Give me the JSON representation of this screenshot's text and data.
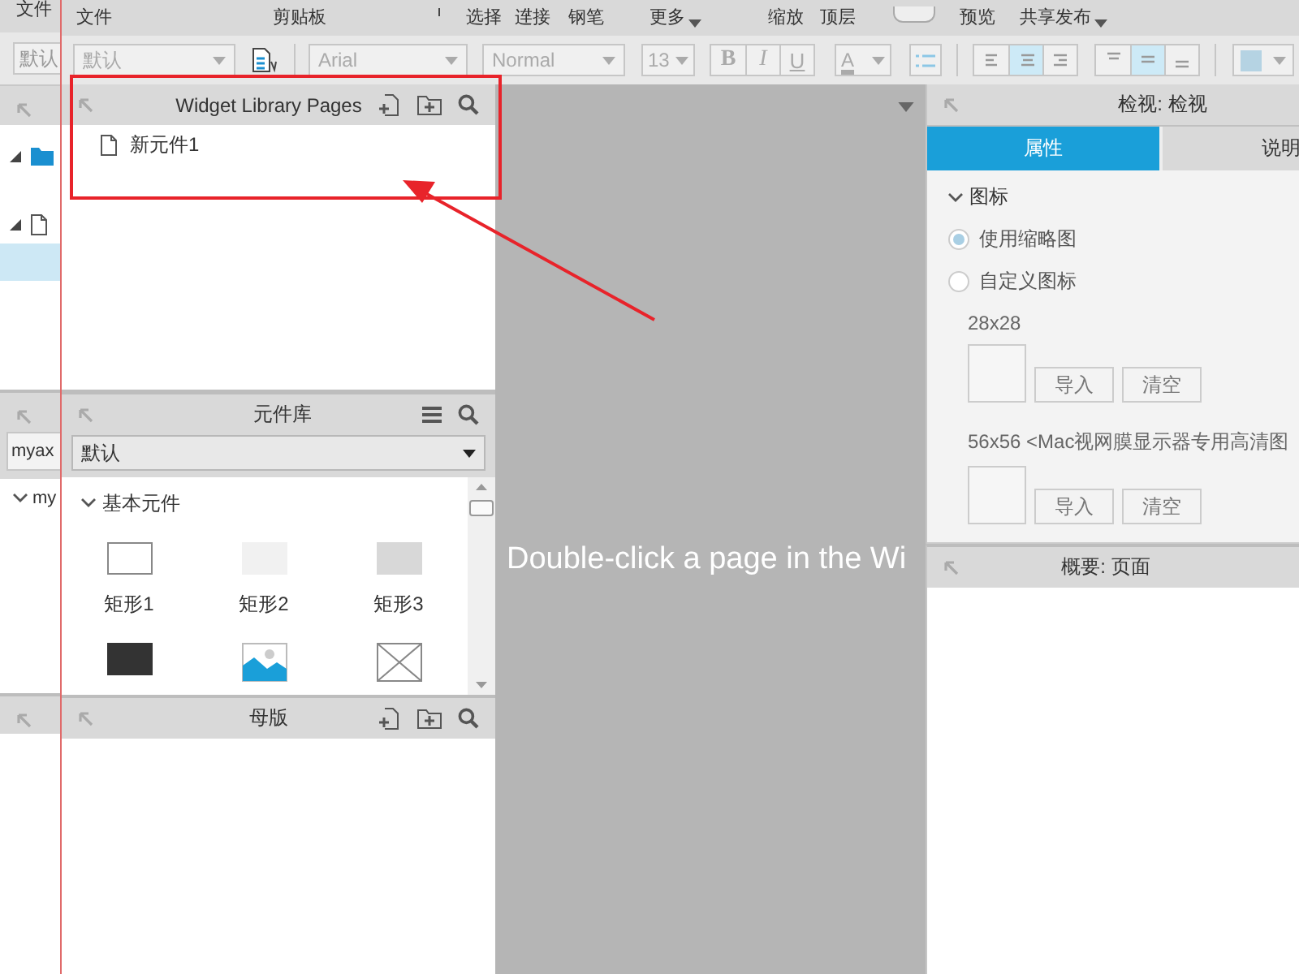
{
  "background_window": {
    "menu_label": "文件",
    "style_value": "默认",
    "tree_rows": [
      {
        "kind": "folder",
        "selected": false
      },
      {
        "kind": "page",
        "selected": false
      },
      {
        "kind": "blank",
        "selected": true
      }
    ],
    "library_field": "myax",
    "library_item": "my"
  },
  "toolbar": [
    {
      "label": "文件",
      "kind": "label"
    },
    {
      "label": "剪贴板",
      "kind": "label"
    },
    {
      "label": "选择",
      "kind": "bracketed"
    },
    {
      "label": "连接",
      "kind": "label"
    },
    {
      "label": "钢笔",
      "kind": "label"
    },
    {
      "label": "更多",
      "kind": "dropdown"
    },
    {
      "label": "缩放",
      "kind": "label"
    },
    {
      "label": "顶层",
      "kind": "label"
    },
    {
      "kind": "toggle",
      "on": false
    },
    {
      "label": "预览",
      "kind": "label"
    },
    {
      "label": "共享",
      "kind": "label"
    },
    {
      "label": "发布",
      "kind": "dropdown"
    }
  ],
  "format_bar": {
    "disabled": true,
    "style": "默认",
    "font": "Arial",
    "weight": "Normal",
    "size": "13",
    "bold": "B",
    "italic": "I",
    "underline": "U",
    "font_color": "A",
    "text_align": [
      {
        "selected": false
      },
      {
        "selected": true
      },
      {
        "selected": false
      }
    ],
    "vertical_align": [
      {
        "selected": false
      },
      {
        "selected": true
      },
      {
        "selected": false
      }
    ]
  },
  "pages_panel": {
    "title": "Widget Library Pages",
    "pages": [
      {
        "label": "新元件1"
      }
    ]
  },
  "library_panel": {
    "title": "元件库",
    "library": "默认",
    "groups": [
      {
        "label": "基本元件",
        "expanded": true,
        "widgets": [
          {
            "label": "矩形1",
            "kind": "outline"
          },
          {
            "label": "矩形2",
            "kind": "light"
          },
          {
            "label": "矩形3",
            "kind": "gray"
          },
          {
            "kind": "dark"
          },
          {
            "kind": "image"
          },
          {
            "kind": "placeholder"
          }
        ]
      }
    ]
  },
  "masters_panel": {
    "title": "母版"
  },
  "canvas": {
    "hint": "Double-click a page in the Wi"
  },
  "inspector": {
    "title": "检视: 检视",
    "tabs": [
      {
        "label": "属性",
        "selected": true
      },
      {
        "label": "说明",
        "selected": false
      }
    ],
    "section": {
      "label": "图标",
      "expanded": true
    },
    "options": [
      {
        "label": "使用缩略图",
        "selected": true
      },
      {
        "label": "自定义图标",
        "selected": false
      }
    ],
    "icon_slots": [
      {
        "size": "28x28",
        "buttons": [
          "导入",
          "清空"
        ]
      },
      {
        "size": "56x56 <Mac视网膜显示器专用高清图",
        "buttons": [
          "导入",
          "清空"
        ]
      }
    ]
  },
  "overview_panel": {
    "title": "概要: 页面"
  }
}
